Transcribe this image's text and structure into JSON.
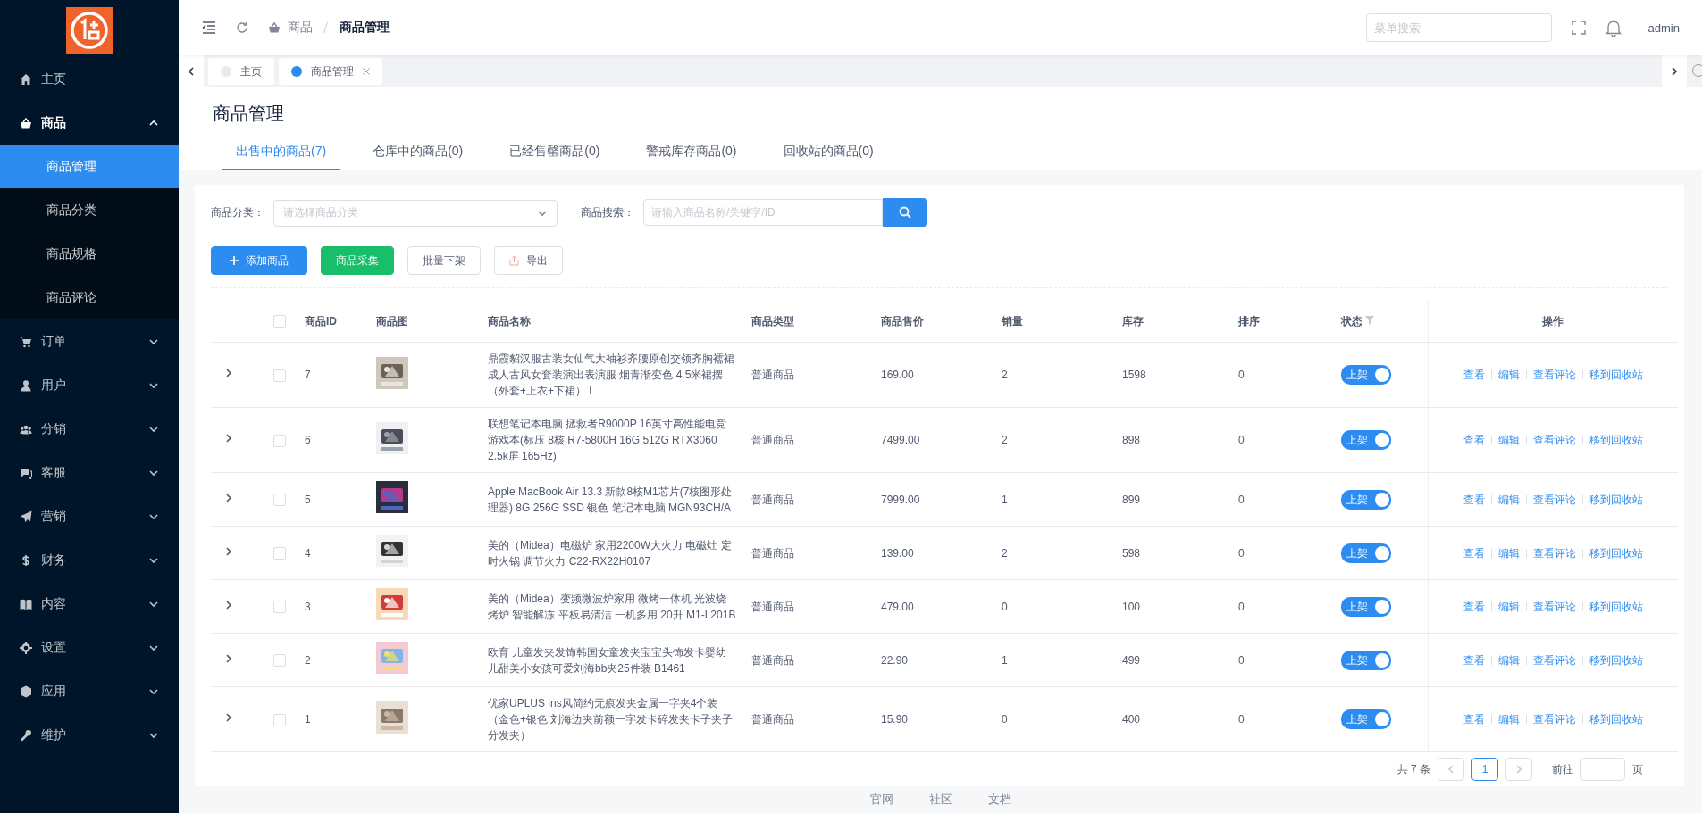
{
  "sidebar": {
    "menu": [
      {
        "label": "主页",
        "kind": "link",
        "selected": false
      },
      {
        "label": "商品",
        "kind": "group",
        "selected": false,
        "expanded": true,
        "children": [
          {
            "label": "商品管理",
            "selected": true
          },
          {
            "label": "商品分类",
            "selected": false
          },
          {
            "label": "商品规格",
            "selected": false
          },
          {
            "label": "商品评论",
            "selected": false
          }
        ]
      },
      {
        "label": "订单",
        "kind": "group",
        "selected": false,
        "expanded": false
      },
      {
        "label": "用户",
        "kind": "group",
        "selected": false,
        "expanded": false
      },
      {
        "label": "分销",
        "kind": "group",
        "selected": false,
        "expanded": false
      },
      {
        "label": "客服",
        "kind": "group",
        "selected": false,
        "expanded": false
      },
      {
        "label": "营销",
        "kind": "group",
        "selected": false,
        "expanded": false
      },
      {
        "label": "财务",
        "kind": "group",
        "selected": false,
        "expanded": false
      },
      {
        "label": "内容",
        "kind": "group",
        "selected": false,
        "expanded": false
      },
      {
        "label": "设置",
        "kind": "group",
        "selected": false,
        "expanded": false
      },
      {
        "label": "应用",
        "kind": "group",
        "selected": false,
        "expanded": false
      },
      {
        "label": "维护",
        "kind": "group",
        "selected": false,
        "expanded": false
      }
    ]
  },
  "header": {
    "breadcrumb": [
      "商品",
      "商品管理"
    ],
    "menu_search": {
      "placeholder": "菜单搜索"
    },
    "user": "admin"
  },
  "page_tabs": [
    {
      "label": "主页",
      "selected": false,
      "closable": false
    },
    {
      "label": "商品管理",
      "selected": true,
      "closable": true
    }
  ],
  "page": {
    "title": "商品管理",
    "tabs": [
      {
        "label": "出售中的商品(7)",
        "selected": true
      },
      {
        "label": "仓库中的商品(0)",
        "selected": false
      },
      {
        "label": "已经售罄商品(0)",
        "selected": false
      },
      {
        "label": "警戒库存商品(0)",
        "selected": false
      },
      {
        "label": "回收站的商品(0)",
        "selected": false
      }
    ],
    "filters": {
      "category_label": "商品分类：",
      "category_placeholder": "请选择商品分类",
      "search_label": "商品搜索：",
      "search_placeholder": "请输入商品名称/关键字/ID"
    },
    "buttons": [
      {
        "label": "添加商品",
        "kind": "primary"
      },
      {
        "label": "商品采集",
        "kind": "success"
      },
      {
        "label": "批量下架",
        "kind": "default"
      },
      {
        "label": "导出",
        "kind": "export"
      }
    ],
    "table": {
      "select_all_checked": false,
      "columns": [
        "商品ID",
        "商品图",
        "商品名称",
        "商品类型",
        "商品售价",
        "销量",
        "库存",
        "排序",
        "状态",
        "操作"
      ],
      "rows": [
        {
          "expanded": false,
          "checked": false,
          "id": "7",
          "name": "鼎霞貂汉服古装女仙气大袖衫齐腰原创交领齐胸襦裙成人古风女套装演出表演服 烟青渐变色 4.5米裙摆（外套+上衣+下裙） L",
          "type": "普通商品",
          "price": "169.00",
          "sales": "2",
          "stock": "1598",
          "sort": "0",
          "status": {
            "label": "上架",
            "on": true
          },
          "actions": [
            "查看",
            "编辑",
            "查看评论",
            "移到回收站"
          ]
        },
        {
          "expanded": false,
          "checked": false,
          "id": "6",
          "name": "联想笔记本电脑 拯救者R9000P 16英寸高性能电竞游戏本(标压 8核 R7-5800H 16G 512G RTX3060 2.5k屏 165Hz)",
          "type": "普通商品",
          "price": "7499.00",
          "sales": "2",
          "stock": "898",
          "sort": "0",
          "status": {
            "label": "上架",
            "on": true
          },
          "actions": [
            "查看",
            "编辑",
            "查看评论",
            "移到回收站"
          ]
        },
        {
          "expanded": false,
          "checked": false,
          "id": "5",
          "name": "Apple MacBook Air 13.3 新款8核M1芯片(7核图形处理器) 8G 256G SSD 银色 笔记本电脑 MGN93CH/A",
          "type": "普通商品",
          "price": "7999.00",
          "sales": "1",
          "stock": "899",
          "sort": "0",
          "status": {
            "label": "上架",
            "on": true
          },
          "actions": [
            "查看",
            "编辑",
            "查看评论",
            "移到回收站"
          ]
        },
        {
          "expanded": false,
          "checked": false,
          "id": "4",
          "name": "美的（Midea）电磁炉 家用2200W大火力 电磁灶 定时火锅 调节火力 C22-RX22H0107",
          "type": "普通商品",
          "price": "139.00",
          "sales": "2",
          "stock": "598",
          "sort": "0",
          "status": {
            "label": "上架",
            "on": true
          },
          "actions": [
            "查看",
            "编辑",
            "查看评论",
            "移到回收站"
          ]
        },
        {
          "expanded": false,
          "checked": false,
          "id": "3",
          "name": "美的（Midea）变频微波炉家用 微烤一体机 光波烧烤炉 智能解冻 平板易清洁 一机多用 20升 M1-L201B",
          "type": "普通商品",
          "price": "479.00",
          "sales": "0",
          "stock": "100",
          "sort": "0",
          "status": {
            "label": "上架",
            "on": true
          },
          "actions": [
            "查看",
            "编辑",
            "查看评论",
            "移到回收站"
          ]
        },
        {
          "expanded": false,
          "checked": false,
          "id": "2",
          "name": "欧育 儿童发夹发饰韩国女童发夹宝宝头饰发卡婴幼儿甜美小女孩可爱刘海bb夹25件装 B1461",
          "type": "普通商品",
          "price": "22.90",
          "sales": "1",
          "stock": "499",
          "sort": "0",
          "status": {
            "label": "上架",
            "on": true
          },
          "actions": [
            "查看",
            "编辑",
            "查看评论",
            "移到回收站"
          ]
        },
        {
          "expanded": false,
          "checked": false,
          "id": "1",
          "name": "优家UPLUS ins风简约无痕发夹金属一字夹4个装（金色+银色 刘海边夹前额一字发卡碎发夹卡子夹子分发夹）",
          "type": "普通商品",
          "price": "15.90",
          "sales": "0",
          "stock": "400",
          "sort": "0",
          "status": {
            "label": "上架",
            "on": true
          },
          "actions": [
            "查看",
            "编辑",
            "查看评论",
            "移到回收站"
          ]
        }
      ]
    },
    "pagination": {
      "total": "共 7 条",
      "pages": [
        {
          "label": "1",
          "selected": true
        }
      ],
      "goto": "前往",
      "unit": "页"
    }
  },
  "footer": {
    "links": [
      "官网",
      "社区",
      "文档"
    ]
  }
}
